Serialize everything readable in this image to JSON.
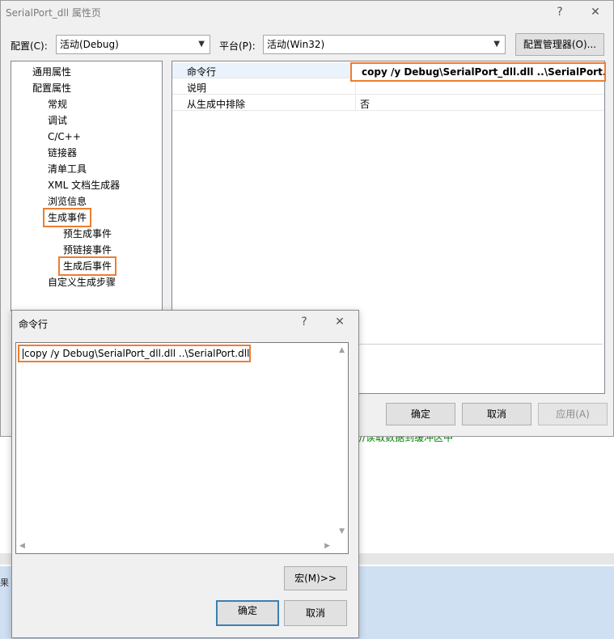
{
  "main_window": {
    "title": "SerialPort_dll 属性页",
    "help": "?",
    "close": "✕"
  },
  "config": {
    "label": "配置(C):",
    "value": "活动(Debug)",
    "platform_label": "平台(P):",
    "platform_value": "活动(Win32)",
    "manager_button": "配置管理器(O)..."
  },
  "tree": {
    "items": [
      {
        "label": "通用属性"
      },
      {
        "label": "配置属性"
      },
      {
        "label": "常规"
      },
      {
        "label": "调试"
      },
      {
        "label": "C/C++"
      },
      {
        "label": "链接器"
      },
      {
        "label": "清单工具"
      },
      {
        "label": "XML 文档生成器"
      },
      {
        "label": "浏览信息"
      },
      {
        "label": "生成事件"
      },
      {
        "label": "预生成事件"
      },
      {
        "label": "预链接事件"
      },
      {
        "label": "生成后事件"
      },
      {
        "label": "自定义生成步骤"
      }
    ]
  },
  "grid": {
    "rows": [
      {
        "name": "命令行",
        "value": "copy /y Debug\\SerialPort_dll.dll ..\\SerialPort.dll"
      },
      {
        "name": "说明",
        "value": ""
      },
      {
        "name": "从生成中排除",
        "value": "否"
      }
    ]
  },
  "main_buttons": {
    "ok": "确定",
    "cancel": "取消",
    "apply": "应用(A)"
  },
  "editor": {
    "comment": "//读取数据到缓冲区中",
    "strip_glyph": "果"
  },
  "cmd_dialog": {
    "title": "命令行",
    "help": "?",
    "close": "✕",
    "text": "copy /y Debug\\SerialPort_dll.dll ..\\SerialPort.dll",
    "macros_button": "宏(M)>>",
    "ok": "确定",
    "cancel": "取消"
  },
  "colors": {
    "highlight_border": "#ed7d31",
    "default_button_border": "#3c7fb1"
  }
}
